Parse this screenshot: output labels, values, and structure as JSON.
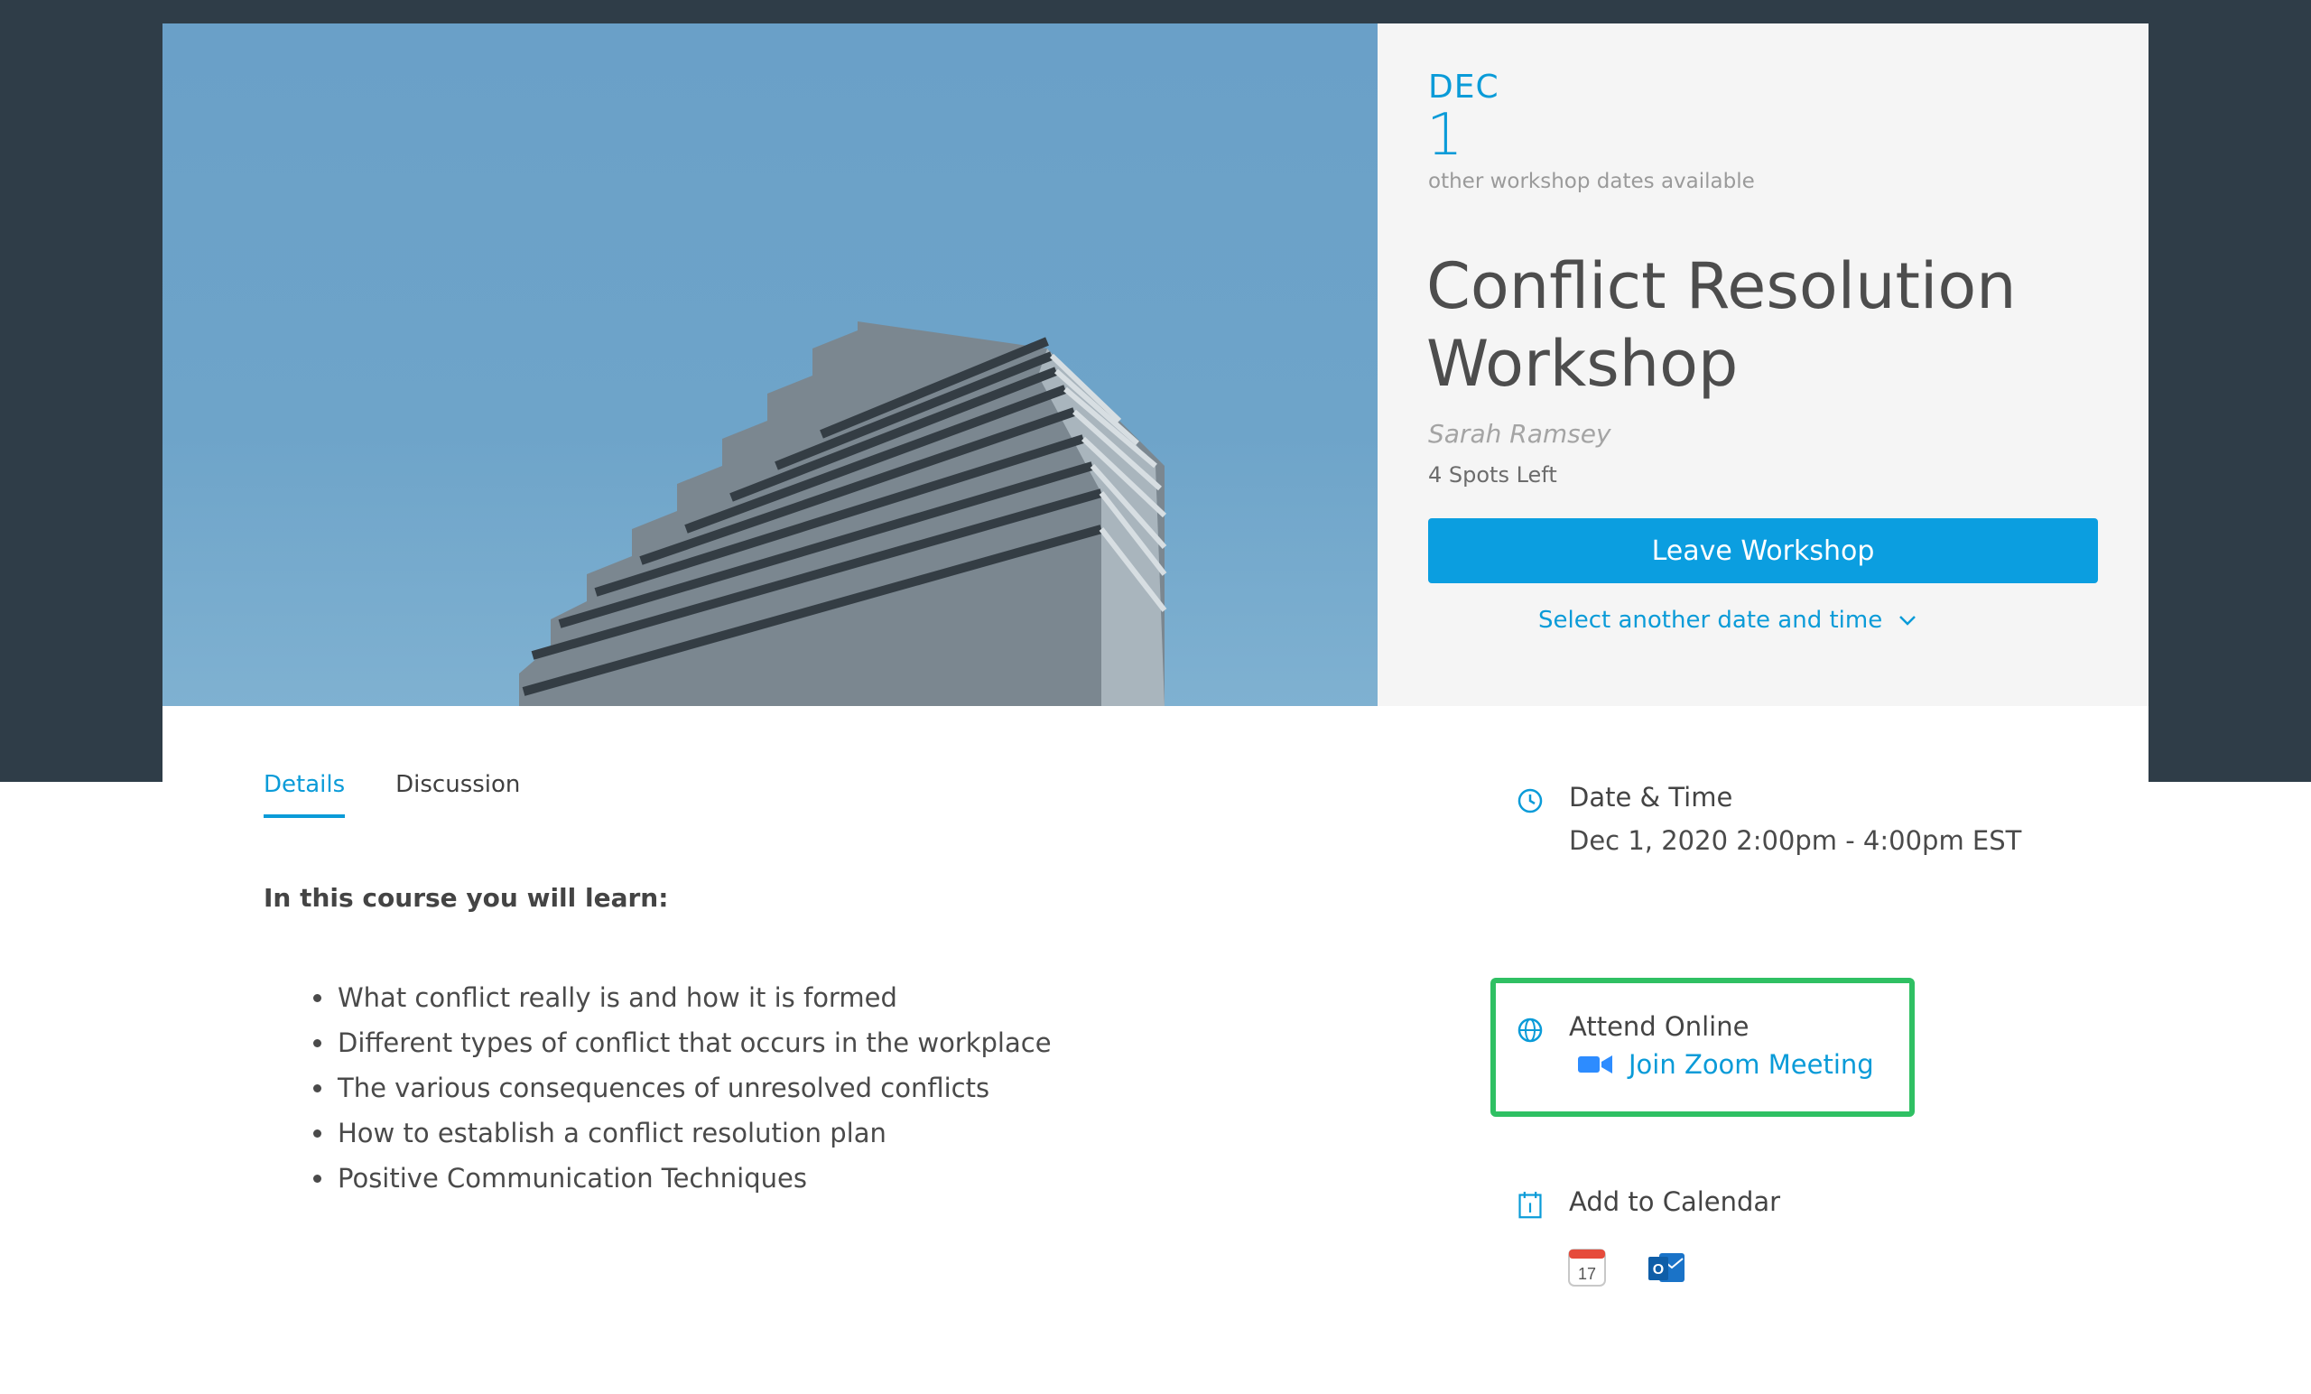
{
  "event": {
    "month": "DEC",
    "day": "1",
    "other_dates": "other workshop dates available",
    "title": "Conflict Resolution Workshop",
    "instructor": "Sarah Ramsey",
    "spots": "4 Spots Left",
    "leave_label": "Leave Workshop",
    "select_date_label": "Select another date and time"
  },
  "tabs": [
    {
      "label": "Details",
      "active": true
    },
    {
      "label": "Discussion",
      "active": false
    }
  ],
  "details": {
    "heading": "In this course you will learn:",
    "items": [
      "What conflict really is and how it is formed",
      "Different types of conflict that occurs in the workplace",
      "The various consequences of unresolved conflicts",
      "How to establish a conflict resolution plan",
      "Positive Communication Techniques"
    ]
  },
  "sidebar": {
    "date_time": {
      "heading": "Date & Time",
      "value": "Dec 1, 2020 2:00pm - 4:00pm EST",
      "icon": "clock-icon"
    },
    "attend": {
      "heading": "Attend Online",
      "link": "Join Zoom Meeting",
      "icon": "globe-icon",
      "link_icon": "video-camera-icon"
    },
    "calendar": {
      "heading": "Add to Calendar",
      "icon": "calendar-icon",
      "apple_icon": "apple-calendar-icon",
      "apple_icon_text": "17",
      "outlook_icon": "outlook-icon",
      "outlook_icon_text": "O"
    }
  },
  "colors": {
    "accent": "#0b9ee0",
    "highlight": "#2fc063",
    "band": "#2f3d48"
  }
}
